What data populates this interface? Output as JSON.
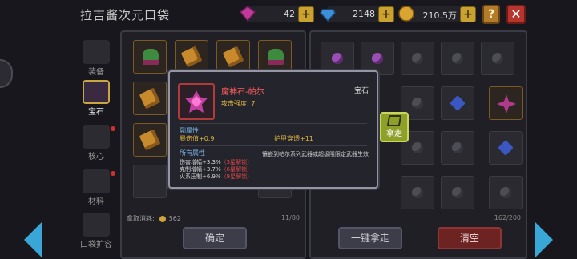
{
  "header": {
    "title": "拉吉酱次元口袋",
    "resources": [
      {
        "icon": "purple-gem-icon",
        "value": "42"
      },
      {
        "icon": "blue-diamond-icon",
        "value": "2148"
      },
      {
        "icon": "gold-coin-icon",
        "value": "210.5万"
      }
    ],
    "plus": "+",
    "help": "?",
    "close": "✕"
  },
  "categories": [
    {
      "label": "装备",
      "icon": "equipment-icon"
    },
    {
      "label": "宝石",
      "icon": "gem-icon",
      "active": true
    },
    {
      "label": "核心",
      "icon": "core-icon"
    },
    {
      "label": "材料",
      "icon": "material-icon"
    },
    {
      "label": "口袋扩容",
      "icon": "chest-icon"
    }
  ],
  "left_panel": {
    "cost_label": "拿取消耗:",
    "cost_value": "562",
    "count": "11/80",
    "confirm": "确定"
  },
  "right_panel": {
    "count": "162/200",
    "take_all": "一键拿走",
    "clear": "清空"
  },
  "take_button": {
    "label": "拿走"
  },
  "tooltip": {
    "name": "魔神石-帕尔",
    "type": "宝石",
    "attack": "攻击强度: 7",
    "sub_title": "副属性",
    "sub_stats": [
      "暴伤值+0.9",
      "护甲穿透+11"
    ],
    "own_title": "所有属性",
    "own_note": "镶嵌到帕尔系列武器或超级阻限定武器生效",
    "bonuses": [
      {
        "text": "伤害增幅+3.3%",
        "req": "（3星解锁）"
      },
      {
        "text": "克制增幅+3.7%",
        "req": "（6星解锁）"
      },
      {
        "text": "火系压制+6.9%",
        "req": "（9星解锁）"
      }
    ]
  },
  "colors": {
    "accent_gold": "#caa640",
    "tooltip_name": "#ff5c5c",
    "arrow": "#39a6d8"
  }
}
